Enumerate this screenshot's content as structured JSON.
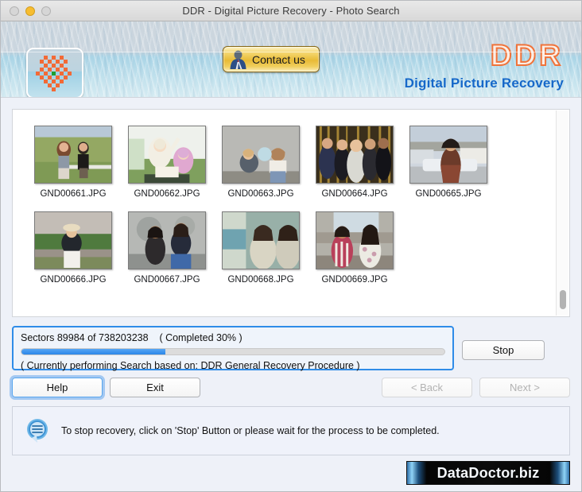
{
  "window": {
    "title": "DDR - Digital Picture Recovery - Photo Search",
    "traffic_lights": [
      "close",
      "minimize",
      "zoom"
    ]
  },
  "header": {
    "logo_icon": "checkered-flower-logo-icon",
    "contact_button": {
      "label": "Contact us",
      "icon": "person-avatar-icon"
    },
    "brand_title": "DDR",
    "brand_subtitle": "Digital Picture Recovery",
    "brand_title_color": "#f0733a",
    "brand_subtitle_color": "#1668c9"
  },
  "thumbnails": {
    "rows": [
      [
        {
          "name": "GND00661.JPG",
          "scene": "couple-in-field"
        },
        {
          "name": "GND00662.JPG",
          "scene": "two-women-cheering"
        },
        {
          "name": "GND00663.JPG",
          "scene": "children-with-balloon"
        },
        {
          "name": "GND00664.JPG",
          "scene": "group-of-five-at-party"
        },
        {
          "name": "GND00665.JPG",
          "scene": "woman-in-striped-dress"
        }
      ],
      [
        {
          "name": "GND00666.JPG",
          "scene": "man-sitting-on-wall"
        },
        {
          "name": "GND00667.JPG",
          "scene": "two-women-by-mural"
        },
        {
          "name": "GND00668.JPG",
          "scene": "two-women-in-sweaters"
        },
        {
          "name": "GND00669.JPG",
          "scene": "two-women-indoors"
        }
      ]
    ],
    "scrollbar_position": "near-bottom"
  },
  "progress": {
    "status_line": "Sectors 89984 of 738203238    ( Completed 30% )",
    "sectors_done": 89984,
    "sectors_total": 738203238,
    "percent_complete": 30,
    "bar_fill_percent": 34,
    "bar_fill_color": "#2a86e8",
    "activity_line": "( Currently performing Search based on: DDR General Recovery Procedure )",
    "stop_label": "Stop"
  },
  "nav": {
    "help_label": "Help",
    "exit_label": "Exit",
    "back_label": "< Back",
    "next_label": "Next >",
    "back_enabled": false,
    "next_enabled": false,
    "focused_button": "Help"
  },
  "hint": {
    "icon": "speech-bubble-icon",
    "text": "To stop recovery, click on 'Stop' Button or please wait for the process to be completed."
  },
  "watermark": {
    "text": "DataDoctor.biz"
  }
}
